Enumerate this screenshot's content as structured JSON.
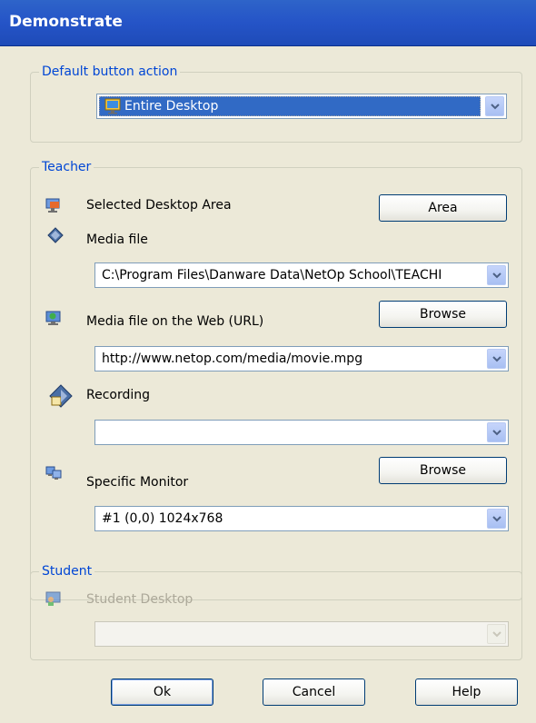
{
  "window": {
    "title": "Demonstrate"
  },
  "default_action": {
    "legend": "Default button action",
    "selected": "Entire Desktop"
  },
  "teacher": {
    "legend": "Teacher",
    "selected_area_label": "Selected Desktop Area",
    "area_button": "Area",
    "media_file_label": "Media file",
    "media_file_value": "C:\\Program Files\\Danware Data\\NetOp School\\TEACHI",
    "media_browse_button": "Browse",
    "media_url_label": "Media file on the Web (URL)",
    "media_url_value": "http://www.netop.com/media/movie.mpg",
    "recording_label": "Recording",
    "recording_value": "",
    "recording_browse_button": "Browse",
    "monitor_label": "Specific Monitor",
    "monitor_value": "#1 (0,0) 1024x768"
  },
  "student": {
    "legend": "Student",
    "desktop_label": "Student Desktop",
    "desktop_value": ""
  },
  "footer": {
    "ok": "Ok",
    "cancel": "Cancel",
    "help": "Help"
  },
  "icons": {
    "entire_desktop": "monitor-icon",
    "selected_area": "monitor-area-icon",
    "media_file": "film-icon",
    "media_url": "globe-monitor-icon",
    "recording": "recording-icon",
    "monitor": "dual-monitor-icon",
    "student_desktop": "student-desktop-icon"
  }
}
